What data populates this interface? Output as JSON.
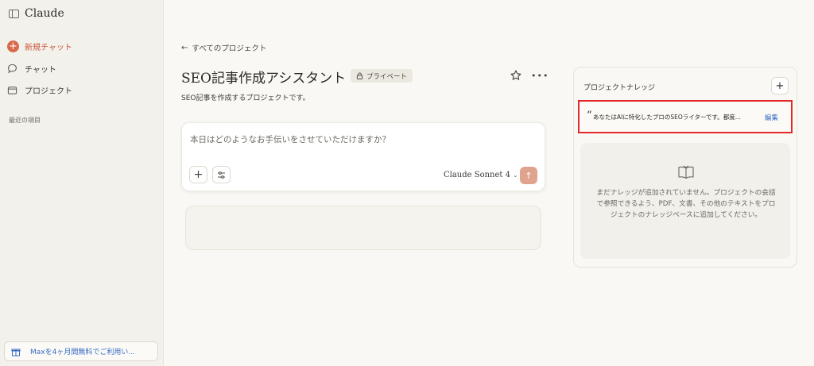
{
  "sidebar": {
    "brand": "Claude",
    "new_chat": "新規チャット",
    "chat": "チャット",
    "projects": "プロジェクト",
    "recent_label": "最近の項目",
    "upgrade_text": "Maxを4ヶ月間無料でご利用い..."
  },
  "header": {
    "back_label": "すべてのプロジェクト",
    "title": "SEO記事作成アシスタント",
    "badge": "プライベート",
    "description": "SEO記事を作成するプロジェクトです。"
  },
  "composer": {
    "placeholder": "本日はどのようなお手伝いをさせていただけますか？",
    "model": "Claude Sonnet 4",
    "model_chevron": "⌄",
    "plus": "+",
    "send": "↑"
  },
  "knowledge": {
    "title": "プロジェクトナレッジ",
    "add": "+",
    "instruction_quote": "“",
    "instruction_text": "あなたはAIに特化したプロのSEOライターです。都度...",
    "edit_label": "編集",
    "empty_text": "まだナレッジが追加されていません。プロジェクトの会話で参照できるよう、PDF、文書、その他のテキストをプロジェクトのナレッジベースに追加してください。"
  },
  "colors": {
    "accent": "#d8694a",
    "highlight_border": "#e42727",
    "link": "#3569c4",
    "send_button": "#e0a48e"
  },
  "icons": {
    "sidebar": "sidebar-toggle-icon",
    "chat": "chat-bubble-icon",
    "projects": "folder-icon",
    "gift": "gift-icon",
    "lock": "lock-icon",
    "star": "star-icon",
    "more": "ellipsis-icon",
    "tools": "sliders-icon",
    "book": "book-icon"
  }
}
